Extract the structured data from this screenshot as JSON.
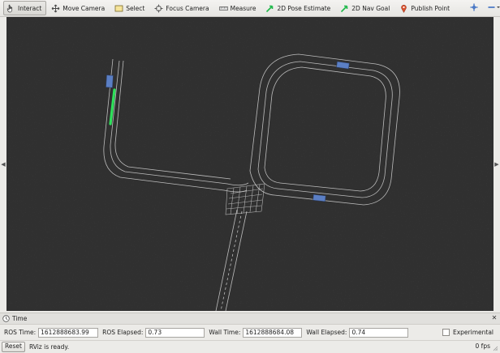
{
  "toolbar": {
    "tools": [
      {
        "label": "Interact",
        "icon": "hand-pointer-icon",
        "active": true
      },
      {
        "label": "Move Camera",
        "icon": "move-arrows-icon",
        "active": false
      },
      {
        "label": "Select",
        "icon": "select-box-icon",
        "active": false
      },
      {
        "label": "Focus Camera",
        "icon": "crosshair-icon",
        "active": false
      },
      {
        "label": "Measure",
        "icon": "ruler-icon",
        "active": false
      },
      {
        "label": "2D Pose Estimate",
        "icon": "green-arrow-icon",
        "active": false
      },
      {
        "label": "2D Nav Goal",
        "icon": "green-arrow-icon",
        "active": false
      },
      {
        "label": "Publish Point",
        "icon": "map-pin-icon",
        "active": false
      }
    ],
    "extra_icons": [
      "plus-crosshair-icon",
      "minus-dropdown-icon",
      "eye-dropdown-icon"
    ]
  },
  "viewport": {
    "background": "#303030",
    "road_color": "#d6d6d6",
    "vehicle_color": "#5b7fc4",
    "path_color": "#2ee05a"
  },
  "time_panel": {
    "title": "Time",
    "ros_time_label": "ROS Time:",
    "ros_time": "1612888683.99",
    "ros_elapsed_label": "ROS Elapsed:",
    "ros_elapsed": "0.73",
    "wall_time_label": "Wall Time:",
    "wall_time": "1612888684.08",
    "wall_elapsed_label": "Wall Elapsed:",
    "wall_elapsed": "0.74",
    "experimental_label": "Experimental"
  },
  "status_bar": {
    "reset_label": "Reset",
    "status": "RViz is ready.",
    "fps": "0 fps"
  }
}
